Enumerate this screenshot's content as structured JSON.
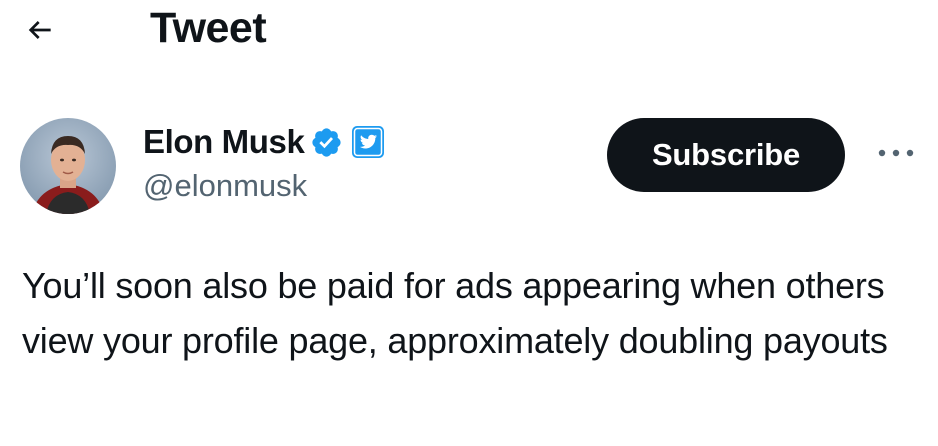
{
  "header": {
    "title": "Tweet",
    "back_icon": "arrow-left-icon"
  },
  "author": {
    "display_name": "Elon Musk",
    "handle": "@elonmusk",
    "verified_icon": "verified-badge-icon",
    "affiliate_icon": "twitter-affiliate-icon",
    "verified_color": "#1d9bf0"
  },
  "actions": {
    "subscribe_label": "Subscribe",
    "more_icon": "more-horizontal-icon"
  },
  "tweet": {
    "text": "You’ll soon also be paid for ads appearing when others view your profile page, approximately doubling payouts"
  },
  "colors": {
    "text_primary": "#0f1419",
    "text_secondary": "#536471",
    "button_bg": "#0f1419",
    "accent": "#1d9bf0"
  }
}
